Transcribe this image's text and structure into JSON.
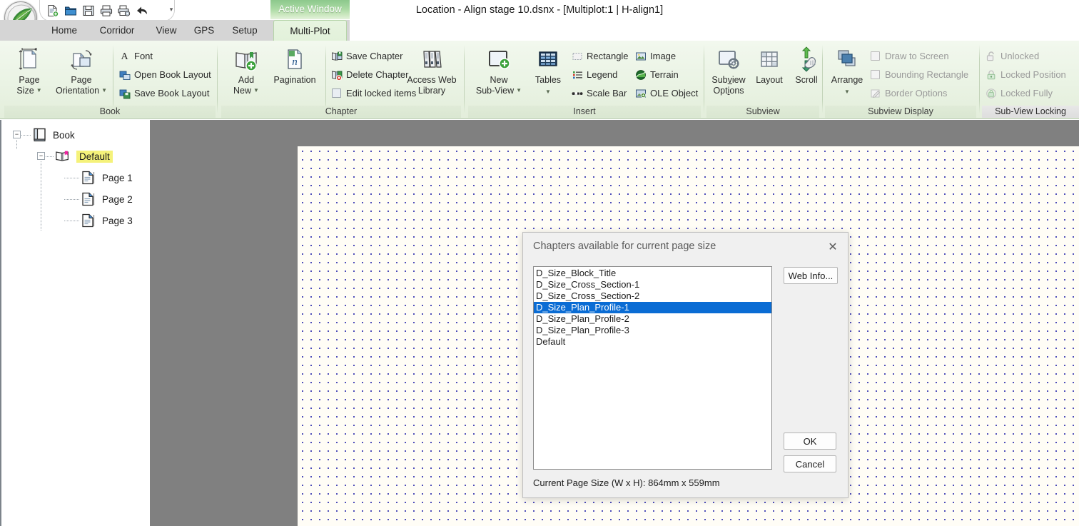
{
  "window": {
    "title": "Location - Align stage 10.dsnx - [Multiplot:1 | H-align1]",
    "contextual_tab": "Active Window"
  },
  "quick_access": {
    "buttons": [
      {
        "name": "new-icon",
        "label": "New"
      },
      {
        "name": "open-folder-icon",
        "label": "Open"
      },
      {
        "name": "save-icon",
        "label": "Save"
      },
      {
        "name": "print-icon",
        "label": "Print"
      },
      {
        "name": "print-setup-icon",
        "label": "Print Setup"
      },
      {
        "name": "undo-icon",
        "label": "Undo"
      }
    ],
    "customize_label": "Customize Quick Access Toolbar"
  },
  "ribbon": {
    "tabs": [
      {
        "label": "Home",
        "selected": false
      },
      {
        "label": "Corridor",
        "selected": false
      },
      {
        "label": "View",
        "selected": false
      },
      {
        "label": "GPS",
        "selected": false
      },
      {
        "label": "Setup",
        "selected": false
      },
      {
        "label": "Multi-Plot",
        "selected": true
      }
    ],
    "groups": [
      {
        "name": "book",
        "label": "Book",
        "big_buttons": [
          {
            "label_line1": "Page",
            "label_line2": "Size",
            "icon": "page-size-icon",
            "has_dropdown": true
          },
          {
            "label_line1": "Page",
            "label_line2": "Orientation",
            "icon": "page-orientation-icon",
            "has_dropdown": true
          }
        ],
        "small_items": [
          {
            "label": "Font",
            "icon": "font-icon",
            "disabled": false
          },
          {
            "label": "Open Book Layout",
            "icon": "open-book-layout-icon",
            "disabled": false
          },
          {
            "label": "Save Book Layout",
            "icon": "save-book-layout-icon",
            "disabled": false
          }
        ]
      },
      {
        "name": "chapter",
        "label": "Chapter",
        "big_buttons": [
          {
            "label_line1": "Add",
            "label_line2": "New",
            "icon": "add-new-chapter-icon",
            "has_dropdown": true
          },
          {
            "label_line1": "Pagination",
            "label_line2": "",
            "icon": "pagination-icon",
            "has_dropdown": false
          },
          {
            "label_line1": "Access Web",
            "label_line2": "Library",
            "icon": "access-web-library-icon",
            "has_dropdown": false
          }
        ],
        "small_items": [
          {
            "label": "Save Chapter",
            "icon": "save-chapter-icon",
            "disabled": false
          },
          {
            "label": "Delete Chapter",
            "icon": "delete-chapter-icon",
            "disabled": false
          },
          {
            "label": "Edit locked items",
            "icon": "checkbox-unchecked-icon",
            "disabled": false
          }
        ]
      },
      {
        "name": "insert",
        "label": "Insert",
        "big_buttons": [
          {
            "label_line1": "New",
            "label_line2": "Sub-View",
            "icon": "new-subview-icon",
            "has_dropdown": true
          },
          {
            "label_line1": "Tables",
            "label_line2": "",
            "icon": "tables-icon",
            "has_dropdown": true
          }
        ],
        "small_items": [
          {
            "label": "Rectangle",
            "icon": "rectangle-icon",
            "has_dropdown": true
          },
          {
            "label": "Legend",
            "icon": "legend-icon",
            "has_dropdown": false
          },
          {
            "label": "Scale Bar",
            "icon": "scale-bar-icon",
            "has_dropdown": false
          },
          {
            "label": "Image",
            "icon": "image-icon",
            "has_dropdown": false
          },
          {
            "label": "Terrain",
            "icon": "terrain-icon",
            "has_dropdown": false
          },
          {
            "label": "OLE Object",
            "icon": "ole-object-icon",
            "has_dropdown": false
          }
        ]
      },
      {
        "name": "subview",
        "label": "Subview",
        "big_buttons": [
          {
            "label_line1": "Subview",
            "label_line2": "Options",
            "icon": "subview-options-icon",
            "has_dropdown": false
          },
          {
            "label_line1": "Layout",
            "label_line2": "",
            "icon": "layout-icon",
            "has_dropdown": false
          },
          {
            "label_line1": "Scroll",
            "label_line2": "",
            "icon": "scroll-icon",
            "has_dropdown": false
          }
        ],
        "small_items": []
      },
      {
        "name": "subview-display",
        "label": "Subview Display",
        "big_buttons": [
          {
            "label_line1": "Arrange",
            "label_line2": "",
            "icon": "arrange-icon",
            "has_dropdown": true
          }
        ],
        "small_items": [
          {
            "label": "Draw to Screen",
            "icon": "checkbox-unchecked-icon",
            "disabled": true
          },
          {
            "label": "Bounding Rectangle",
            "icon": "checkbox-unchecked-icon",
            "disabled": true
          },
          {
            "label": "Border Options",
            "icon": "border-options-icon",
            "disabled": true
          }
        ]
      },
      {
        "name": "sub-view-locking",
        "label": "Sub-View Locking",
        "big_buttons": [],
        "small_items": [
          {
            "label": "Unlocked",
            "icon": "unlocked-icon",
            "disabled": true
          },
          {
            "label": "Locked Position",
            "icon": "locked-position-icon",
            "disabled": true
          },
          {
            "label": "Locked Fully",
            "icon": "locked-fully-icon",
            "disabled": true
          }
        ]
      }
    ]
  },
  "tree": {
    "nodes": [
      {
        "label": "Book",
        "icon": "book-icon",
        "expanded": true,
        "highlighted": false,
        "depth": 0
      },
      {
        "label": "Default",
        "icon": "chapter-icon",
        "expanded": true,
        "highlighted": true,
        "depth": 1
      },
      {
        "label": "Page 1",
        "icon": "page-icon",
        "expanded": null,
        "highlighted": false,
        "depth": 2
      },
      {
        "label": "Page 2",
        "icon": "page-icon",
        "expanded": null,
        "highlighted": false,
        "depth": 2
      },
      {
        "label": "Page 3",
        "icon": "page-icon",
        "expanded": null,
        "highlighted": false,
        "depth": 2
      }
    ]
  },
  "dialog": {
    "title": "Chapters available for current page size",
    "close_label": "✕",
    "list_items": [
      {
        "label": "D_Size_Block_Title",
        "selected": false
      },
      {
        "label": "D_Size_Cross_Section-1",
        "selected": false
      },
      {
        "label": "D_Size_Cross_Section-2",
        "selected": false
      },
      {
        "label": "D_Size_Plan_Profile-1",
        "selected": true
      },
      {
        "label": "D_Size_Plan_Profile-2",
        "selected": false
      },
      {
        "label": "D_Size_Plan_Profile-3",
        "selected": false
      },
      {
        "label": "Default",
        "selected": false
      }
    ],
    "web_info_label": "Web Info...",
    "ok_label": "OK",
    "cancel_label": "Cancel",
    "footer": "Current Page Size (W x H): 864mm x 559mm"
  },
  "colors": {
    "selection_blue": "#0a6cd4",
    "highlight_yellow": "#f5f27a",
    "ribbon_green": "#e3eedb",
    "canvas_gray": "#808080",
    "page_dot_blue": "#2222aa"
  }
}
